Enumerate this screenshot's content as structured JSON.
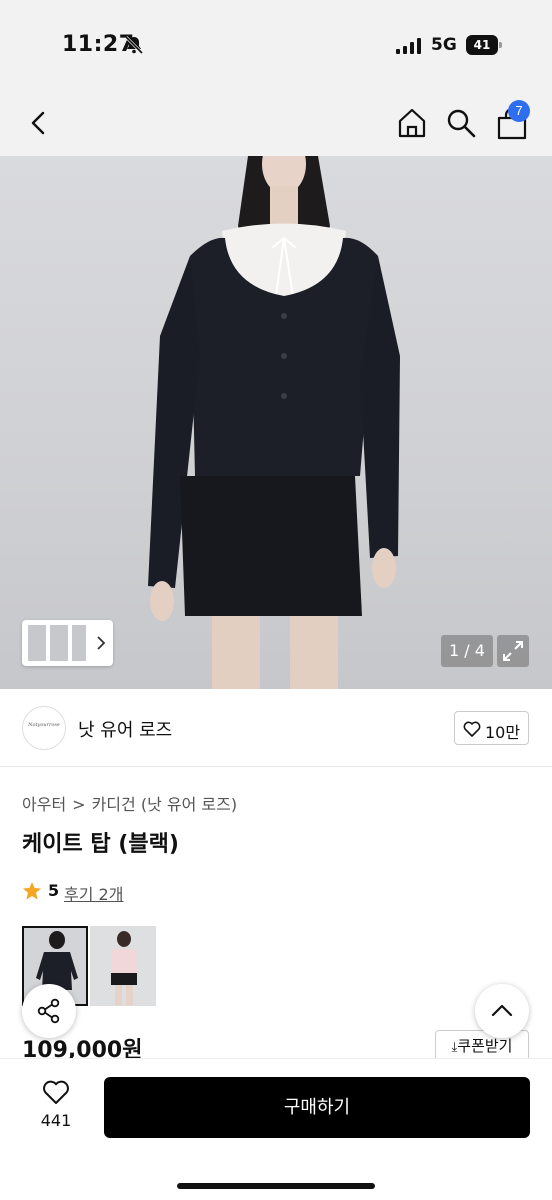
{
  "status_bar": {
    "time": "11:27",
    "network": "5G",
    "battery": "41"
  },
  "nav": {
    "cart_count": "7"
  },
  "gallery": {
    "page_indicator": "1 / 4",
    "current_page": 1,
    "total_pages": 4
  },
  "brand": {
    "name": "낫 유어 로즈",
    "logo_text": "Notyourrose",
    "likes": "10만"
  },
  "breadcrumb": {
    "category": "아우터",
    "subcategory": "카디건 (낫 유어 로즈)"
  },
  "product": {
    "title": "케이트 탑 (블랙)",
    "rating": "5",
    "reviews": "후기 2개",
    "price": "109,000원"
  },
  "coupon": {
    "label": "쿠폰받기"
  },
  "bottom_bar": {
    "wish_count": "441",
    "buy_label": "구매하기"
  },
  "colors": {
    "accent": "#2f6fed",
    "star": "#f5a623",
    "buy_bg": "#000000"
  }
}
